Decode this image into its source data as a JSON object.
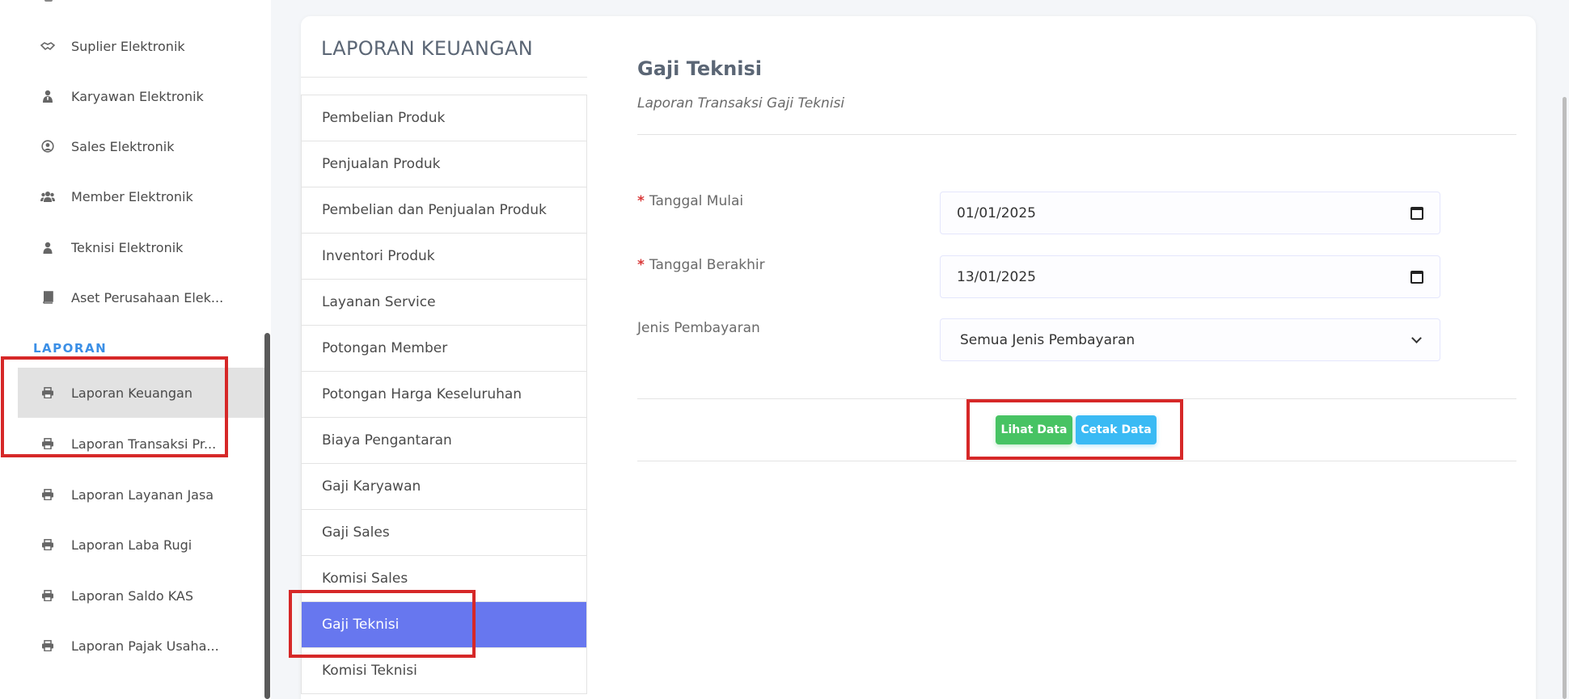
{
  "sidebar": {
    "items": [
      {
        "label": "Suplier Elektronik",
        "icon": "handshake-icon"
      },
      {
        "label": "Karyawan Elektronik",
        "icon": "user-tie-icon"
      },
      {
        "label": "Sales Elektronik",
        "icon": "user-circle-icon"
      },
      {
        "label": "Member Elektronik",
        "icon": "users-icon"
      },
      {
        "label": "Teknisi Elektronik",
        "icon": "user-icon"
      },
      {
        "label": "Aset Perusahaan Elek...",
        "icon": "book-icon"
      }
    ],
    "section_title": "LAPORAN",
    "report_items": [
      {
        "label": "Laporan Keuangan",
        "icon": "print-icon",
        "active": true
      },
      {
        "label": "Laporan Transaksi Pr...",
        "icon": "print-icon"
      },
      {
        "label": "Laporan Layanan Jasa",
        "icon": "print-icon"
      },
      {
        "label": "Laporan Laba Rugi",
        "icon": "print-icon"
      },
      {
        "label": "Laporan Saldo KAS",
        "icon": "print-icon"
      },
      {
        "label": "Laporan Pajak Usaha...",
        "icon": "print-icon"
      }
    ]
  },
  "report_menu": {
    "title": "LAPORAN KEUANGAN",
    "items": [
      "Pembelian Produk",
      "Penjualan Produk",
      "Pembelian dan Penjualan Produk",
      "Inventori Produk",
      "Layanan Service",
      "Potongan Member",
      "Potongan Harga Keseluruhan",
      "Biaya Pengantaran",
      "Gaji Karyawan",
      "Gaji Sales",
      "Komisi Sales",
      "Gaji Teknisi",
      "Komisi Teknisi"
    ],
    "active_index": 11
  },
  "form": {
    "title": "Gaji Teknisi",
    "subtitle": "Laporan Transaksi Gaji Teknisi",
    "start_label": "Tanggal Mulai",
    "start_value": "01/01/2025",
    "end_label": "Tanggal Berakhir",
    "end_value": "13/01/2025",
    "payment_label": "Jenis Pembayaran",
    "payment_value": "Semua Jenis Pembayaran",
    "required_mark": "*",
    "view_button": "Lihat Data",
    "print_button": "Cetak Data"
  },
  "colors": {
    "active_menu": "#6777ef",
    "section_title": "#3b8fe6",
    "view_button": "#47c363",
    "print_button": "#3abaf4",
    "annotation": "#d62828"
  }
}
